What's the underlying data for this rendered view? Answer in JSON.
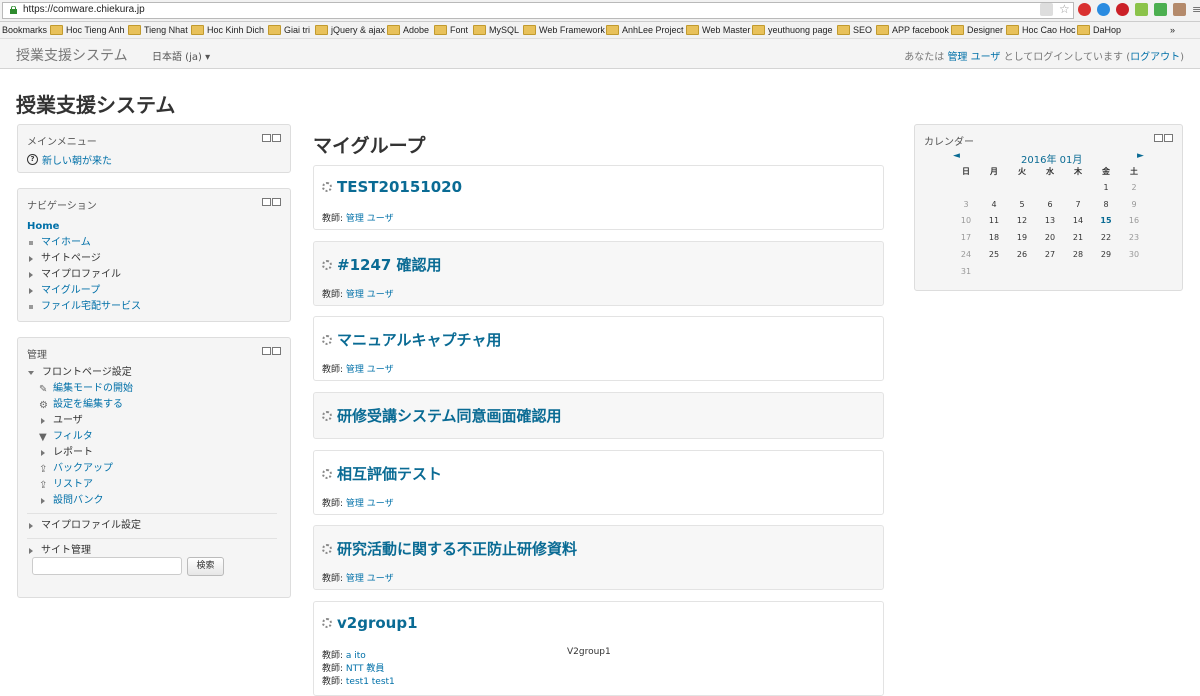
{
  "browser": {
    "url": "https://comware.chiekura.jp",
    "bookmarks_label": "Bookmarks",
    "bookmarks": [
      "Hoc Tieng Anh",
      "Tieng Nhat",
      "Hoc Kinh Dich",
      "Giai tri",
      "jQuery & ajax",
      "Adobe",
      "Font",
      "MySQL",
      "Web Framework",
      "AnhLee Project",
      "Web Master",
      "yeuthuong page",
      "SEO",
      "APP facebook",
      "Designer",
      "Hoc Cao Hoc",
      "DaHop"
    ],
    "more": "»"
  },
  "navbar": {
    "brand": "授業支援システム",
    "language": "日本語 (ja) ▾",
    "login_prefix": "あなたは",
    "login_user": "管理 ユーザ",
    "login_middle": "としてログインしています (",
    "logout": "ログアウト",
    "login_suffix": ")"
  },
  "site_title": "授業支援システム",
  "main_menu": {
    "title": "メインメニュー",
    "item": "新しい朝が来た"
  },
  "navigation": {
    "title": "ナビゲーション",
    "home": "Home",
    "items": [
      "マイホーム",
      "サイトページ",
      "マイプロファイル",
      "マイグループ",
      "ファイル宅配サービス"
    ]
  },
  "admin": {
    "title": "管理",
    "front_page": "フロントページ設定",
    "sub_items": [
      "編集モードの開始",
      "設定を編集する",
      "ユーザ",
      "フィルタ",
      "レポート",
      "バックアップ",
      "リストア",
      "設問バンク"
    ],
    "profile_settings": "マイプロファイル設定",
    "site_admin": "サイト管理",
    "search_button": "検索"
  },
  "main": {
    "title": "マイグループ",
    "teacher_label": "教師: ",
    "courses": [
      {
        "title": "TEST20151020",
        "teachers": [
          "管理 ユーザ"
        ],
        "summary": ""
      },
      {
        "title": "#1247 確認用",
        "teachers": [
          "管理 ユーザ"
        ],
        "summary": ""
      },
      {
        "title": "マニュアルキャプチャ用",
        "teachers": [
          "管理 ユーザ"
        ],
        "summary": ""
      },
      {
        "title": "研修受講システム同意画面確認用",
        "teachers": [],
        "summary": ""
      },
      {
        "title": "相互評価テスト",
        "teachers": [
          "管理 ユーザ"
        ],
        "summary": ""
      },
      {
        "title": "研究活動に関する不正防止研修資料",
        "teachers": [
          "管理 ユーザ"
        ],
        "summary": ""
      },
      {
        "title": "v2group1",
        "teachers": [
          "a ito",
          "NTT 教員",
          "test1 test1"
        ],
        "summary": "V2group1"
      }
    ]
  },
  "calendar": {
    "title": "カレンダー",
    "prev": "◄",
    "next": "►",
    "month": "2016年 01月",
    "weekdays": [
      "日",
      "月",
      "火",
      "水",
      "木",
      "金",
      "土"
    ],
    "days": [
      "",
      "",
      "",
      "",
      "",
      "1",
      "2",
      "3",
      "4",
      "5",
      "6",
      "7",
      "8",
      "9",
      "10",
      "11",
      "12",
      "13",
      "14",
      "15",
      "16",
      "17",
      "18",
      "19",
      "20",
      "21",
      "22",
      "23",
      "24",
      "25",
      "26",
      "27",
      "28",
      "29",
      "30",
      "31"
    ],
    "today": "15"
  }
}
